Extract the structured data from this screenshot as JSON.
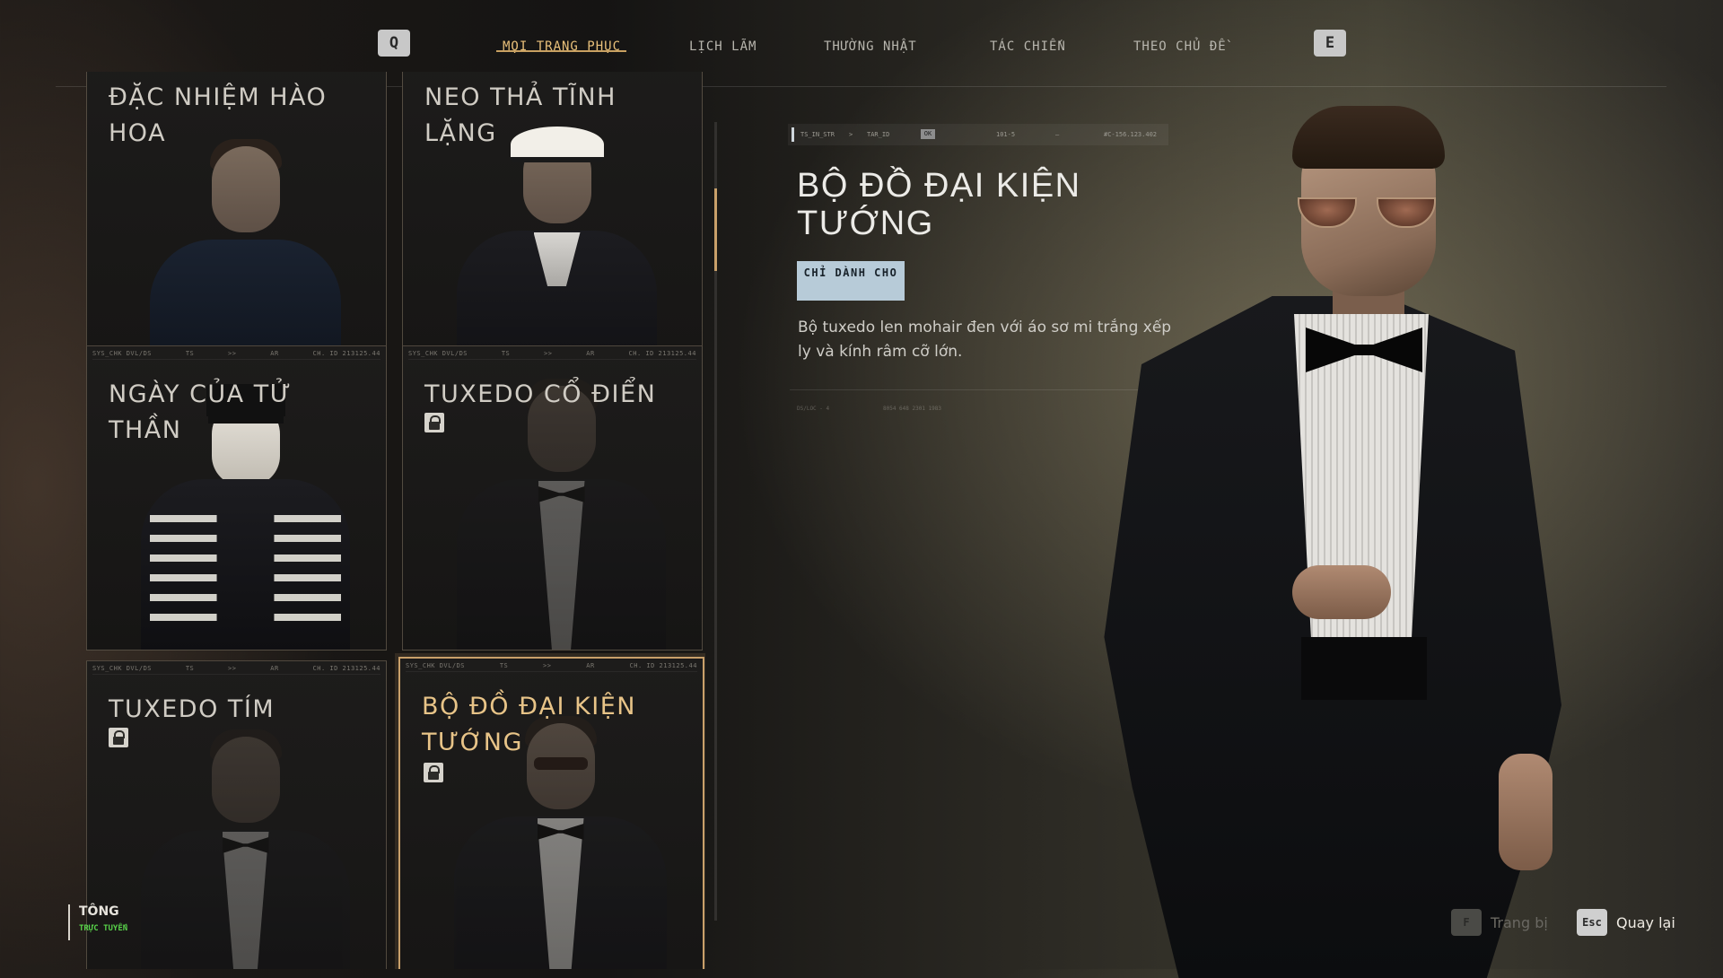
{
  "nav": {
    "prev_key": "Q",
    "next_key": "E",
    "tabs": [
      {
        "label": "MỌI TRANG PHỤC",
        "active": true
      },
      {
        "label": "LỊCH LÃM",
        "active": false
      },
      {
        "label": "THƯỜNG NHẬT",
        "active": false
      },
      {
        "label": "TÁC CHIẾN",
        "active": false
      },
      {
        "label": "THEO CHỦ ĐỀ",
        "active": false
      }
    ]
  },
  "outfits": [
    {
      "title": "ĐẶC NHIỆM HÀO HOA",
      "strip": [],
      "locked": false,
      "selected": false
    },
    {
      "title": "NEO THẢ TĨNH LẶNG",
      "strip": [],
      "locked": false,
      "selected": false
    },
    {
      "title": "NGÀY CỦA TỬ THẦN",
      "strip": [
        "SYS_CHK  DVL/DS",
        "TS",
        ">>",
        "AR",
        "CH. ID 213125.44"
      ],
      "locked": false,
      "selected": false
    },
    {
      "title": "TUXEDO CỔ ĐIỂN",
      "strip": [
        "SYS_CHK  DVL/DS",
        "TS",
        ">>",
        "AR",
        "CH. ID 213125.44"
      ],
      "locked": true,
      "selected": false
    },
    {
      "title": "TUXEDO TÍM",
      "strip": [
        "SYS_CHK  DVL/DS",
        "TS",
        ">>",
        "AR",
        "CH. ID 213125.44"
      ],
      "locked": true,
      "selected": false
    },
    {
      "title": "BỘ ĐỒ ĐẠI KIỆN TƯỚNG",
      "strip": [
        "SYS_CHK  DVL/DS",
        "TS",
        ">>",
        "AR",
        "CH. ID 213125.44"
      ],
      "locked": true,
      "selected": true
    }
  ],
  "detail": {
    "strip": {
      "a": "TS_IN_STR",
      "b": ">",
      "c": "TAR_ID",
      "ok": "OK",
      "d": "101-5",
      "e": "—",
      "f": "#C-156.123.402"
    },
    "title": "BỘ ĐỒ ĐẠI KIỆN TƯỚNG",
    "badge": "CHỈ DÀNH CHO",
    "description": "Bộ tuxedo len mohair đen với áo sơ mi trắng xếp ly và kính râm cỡ lớn.",
    "micro_left": "DS/LOC - 4",
    "micro_right": "8054 648 2301 1983"
  },
  "user": {
    "name": "TÔNG",
    "status": "TRỰC TUYẾN"
  },
  "hints": [
    {
      "key": "F",
      "label": "Trang bị",
      "enabled": false
    },
    {
      "key": "Esc",
      "label": "Quay lại",
      "enabled": true
    }
  ],
  "colors": {
    "accent": "#c9a06a",
    "badge_bg": "#b7cbd8",
    "online": "#58d24a"
  }
}
